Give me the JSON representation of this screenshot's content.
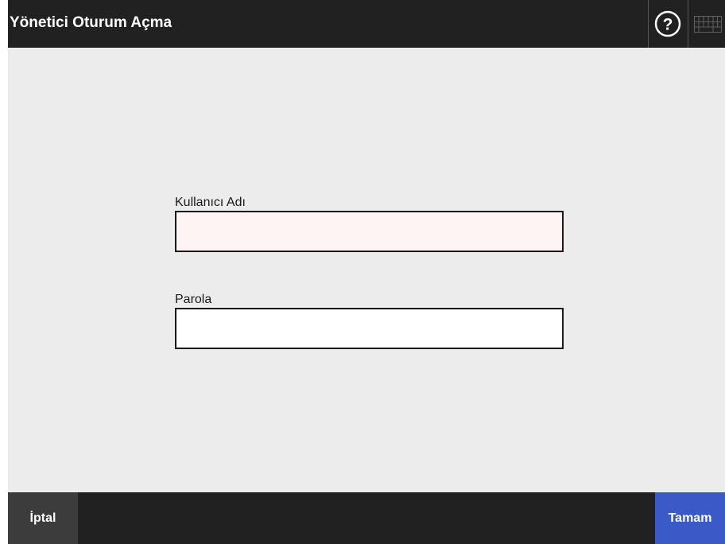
{
  "header": {
    "title": "Yönetici Oturum Açma",
    "help_icon": "question-circle-icon",
    "keyboard_icon": "keyboard-icon"
  },
  "form": {
    "username": {
      "label": "Kullanıcı Adı",
      "value": ""
    },
    "password": {
      "label": "Parola",
      "value": ""
    }
  },
  "footer": {
    "cancel_label": "İptal",
    "ok_label": "Tamam"
  },
  "colors": {
    "titlebar": "#212121",
    "background": "#ececec",
    "cancel_button": "#3c3c3c",
    "ok_button": "#3a5bc7",
    "username_field_bg": "#fcf5f4"
  }
}
